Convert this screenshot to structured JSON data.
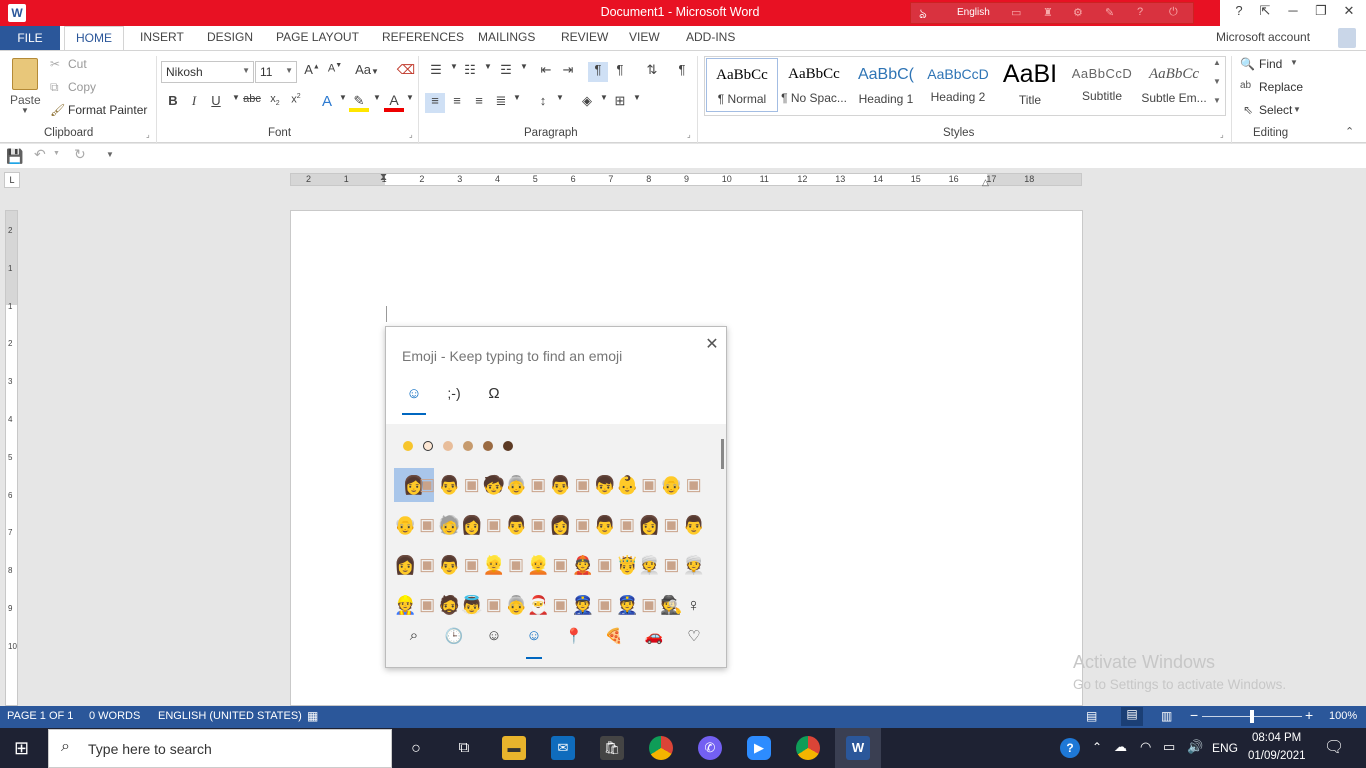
{
  "window": {
    "title": "Document1 - Microsoft Word",
    "language_indicator": "English",
    "help": "?",
    "account": "Microsoft account"
  },
  "tabs": [
    "FILE",
    "HOME",
    "INSERT",
    "DESIGN",
    "PAGE LAYOUT",
    "REFERENCES",
    "MAILINGS",
    "REVIEW",
    "VIEW",
    "ADD-INS"
  ],
  "clipboard": {
    "paste": "Paste",
    "cut": "Cut",
    "copy": "Copy",
    "format_painter": "Format Painter",
    "label": "Clipboard"
  },
  "font": {
    "name": "Nikosh",
    "size": "11",
    "label": "Font",
    "change_case": "Aa"
  },
  "paragraph": {
    "label": "Paragraph"
  },
  "styles": {
    "label": "Styles",
    "items": [
      {
        "sample": "AaBbCc",
        "name": "¶ Normal"
      },
      {
        "sample": "AaBbCc",
        "name": "¶ No Spac..."
      },
      {
        "sample": "AaBbC(",
        "name": "Heading 1"
      },
      {
        "sample": "AaBbCcD",
        "name": "Heading 2"
      },
      {
        "sample": "AaBI",
        "name": "Title"
      },
      {
        "sample": "AaBbCcD",
        "name": "Subtitle"
      },
      {
        "sample": "AaBbCc",
        "name": "Subtle Em..."
      }
    ]
  },
  "editing": {
    "find": "Find",
    "replace": "Replace",
    "select": "Select",
    "label": "Editing"
  },
  "ruler_h_ticks": [
    "2",
    "1",
    "1",
    "2",
    "3",
    "4",
    "5",
    "6",
    "7",
    "8",
    "9",
    "10",
    "11",
    "12",
    "13",
    "14",
    "15",
    "16",
    "17",
    "18"
  ],
  "ruler_v_ticks": [
    "2",
    "1",
    "1",
    "2",
    "3",
    "4",
    "5",
    "6",
    "7",
    "8",
    "9",
    "10"
  ],
  "emoji_panel": {
    "title": "Emoji - Keep typing to find an emoji",
    "tabs": [
      "☺",
      ";-)",
      "Ω"
    ],
    "tones": [
      "#f7c52c",
      "#fde7d4",
      "#e8bd9a",
      "#c69a6d",
      "#9a6a42",
      "#5c3a24"
    ],
    "rows": [
      [
        "👩",
        "▣",
        "👨",
        "▣",
        "🧒",
        "👵",
        "▣",
        "👨",
        "▣",
        "👦",
        "👶",
        "▣",
        "👴",
        "▣"
      ],
      [
        "👴",
        "▣",
        "🧓",
        "👩",
        "▣",
        "👨",
        "▣",
        "👩",
        "▣",
        "👨",
        "▣",
        "👩",
        "▣",
        "👨"
      ],
      [
        "👩",
        "▣",
        "👨",
        "▣",
        "👱",
        "▣",
        "👱",
        "▣",
        "👲",
        "▣",
        "🤴",
        "👳",
        "▣",
        "👳"
      ],
      [
        "👷",
        "▣",
        "🧔",
        "👼",
        "▣",
        "👵",
        "🎅",
        "▣",
        "👮",
        "▣",
        "👮",
        "▣",
        "🕵",
        "♀"
      ]
    ],
    "bottom": [
      "⌕",
      "🕒",
      "☺",
      "☺",
      "📍",
      "🍕",
      "🚗",
      "♡"
    ]
  },
  "watermark": {
    "line1": "Activate Windows",
    "line2": "Go to Settings to activate Windows."
  },
  "status": {
    "page": "PAGE 1 OF 1",
    "words": "0 WORDS",
    "language": "ENGLISH (UNITED STATES)",
    "zoom": "100%"
  },
  "taskbar": {
    "search_placeholder": "Type here to search",
    "lang": "ENG",
    "time": "08:04 PM",
    "date": "01/09/2021"
  }
}
